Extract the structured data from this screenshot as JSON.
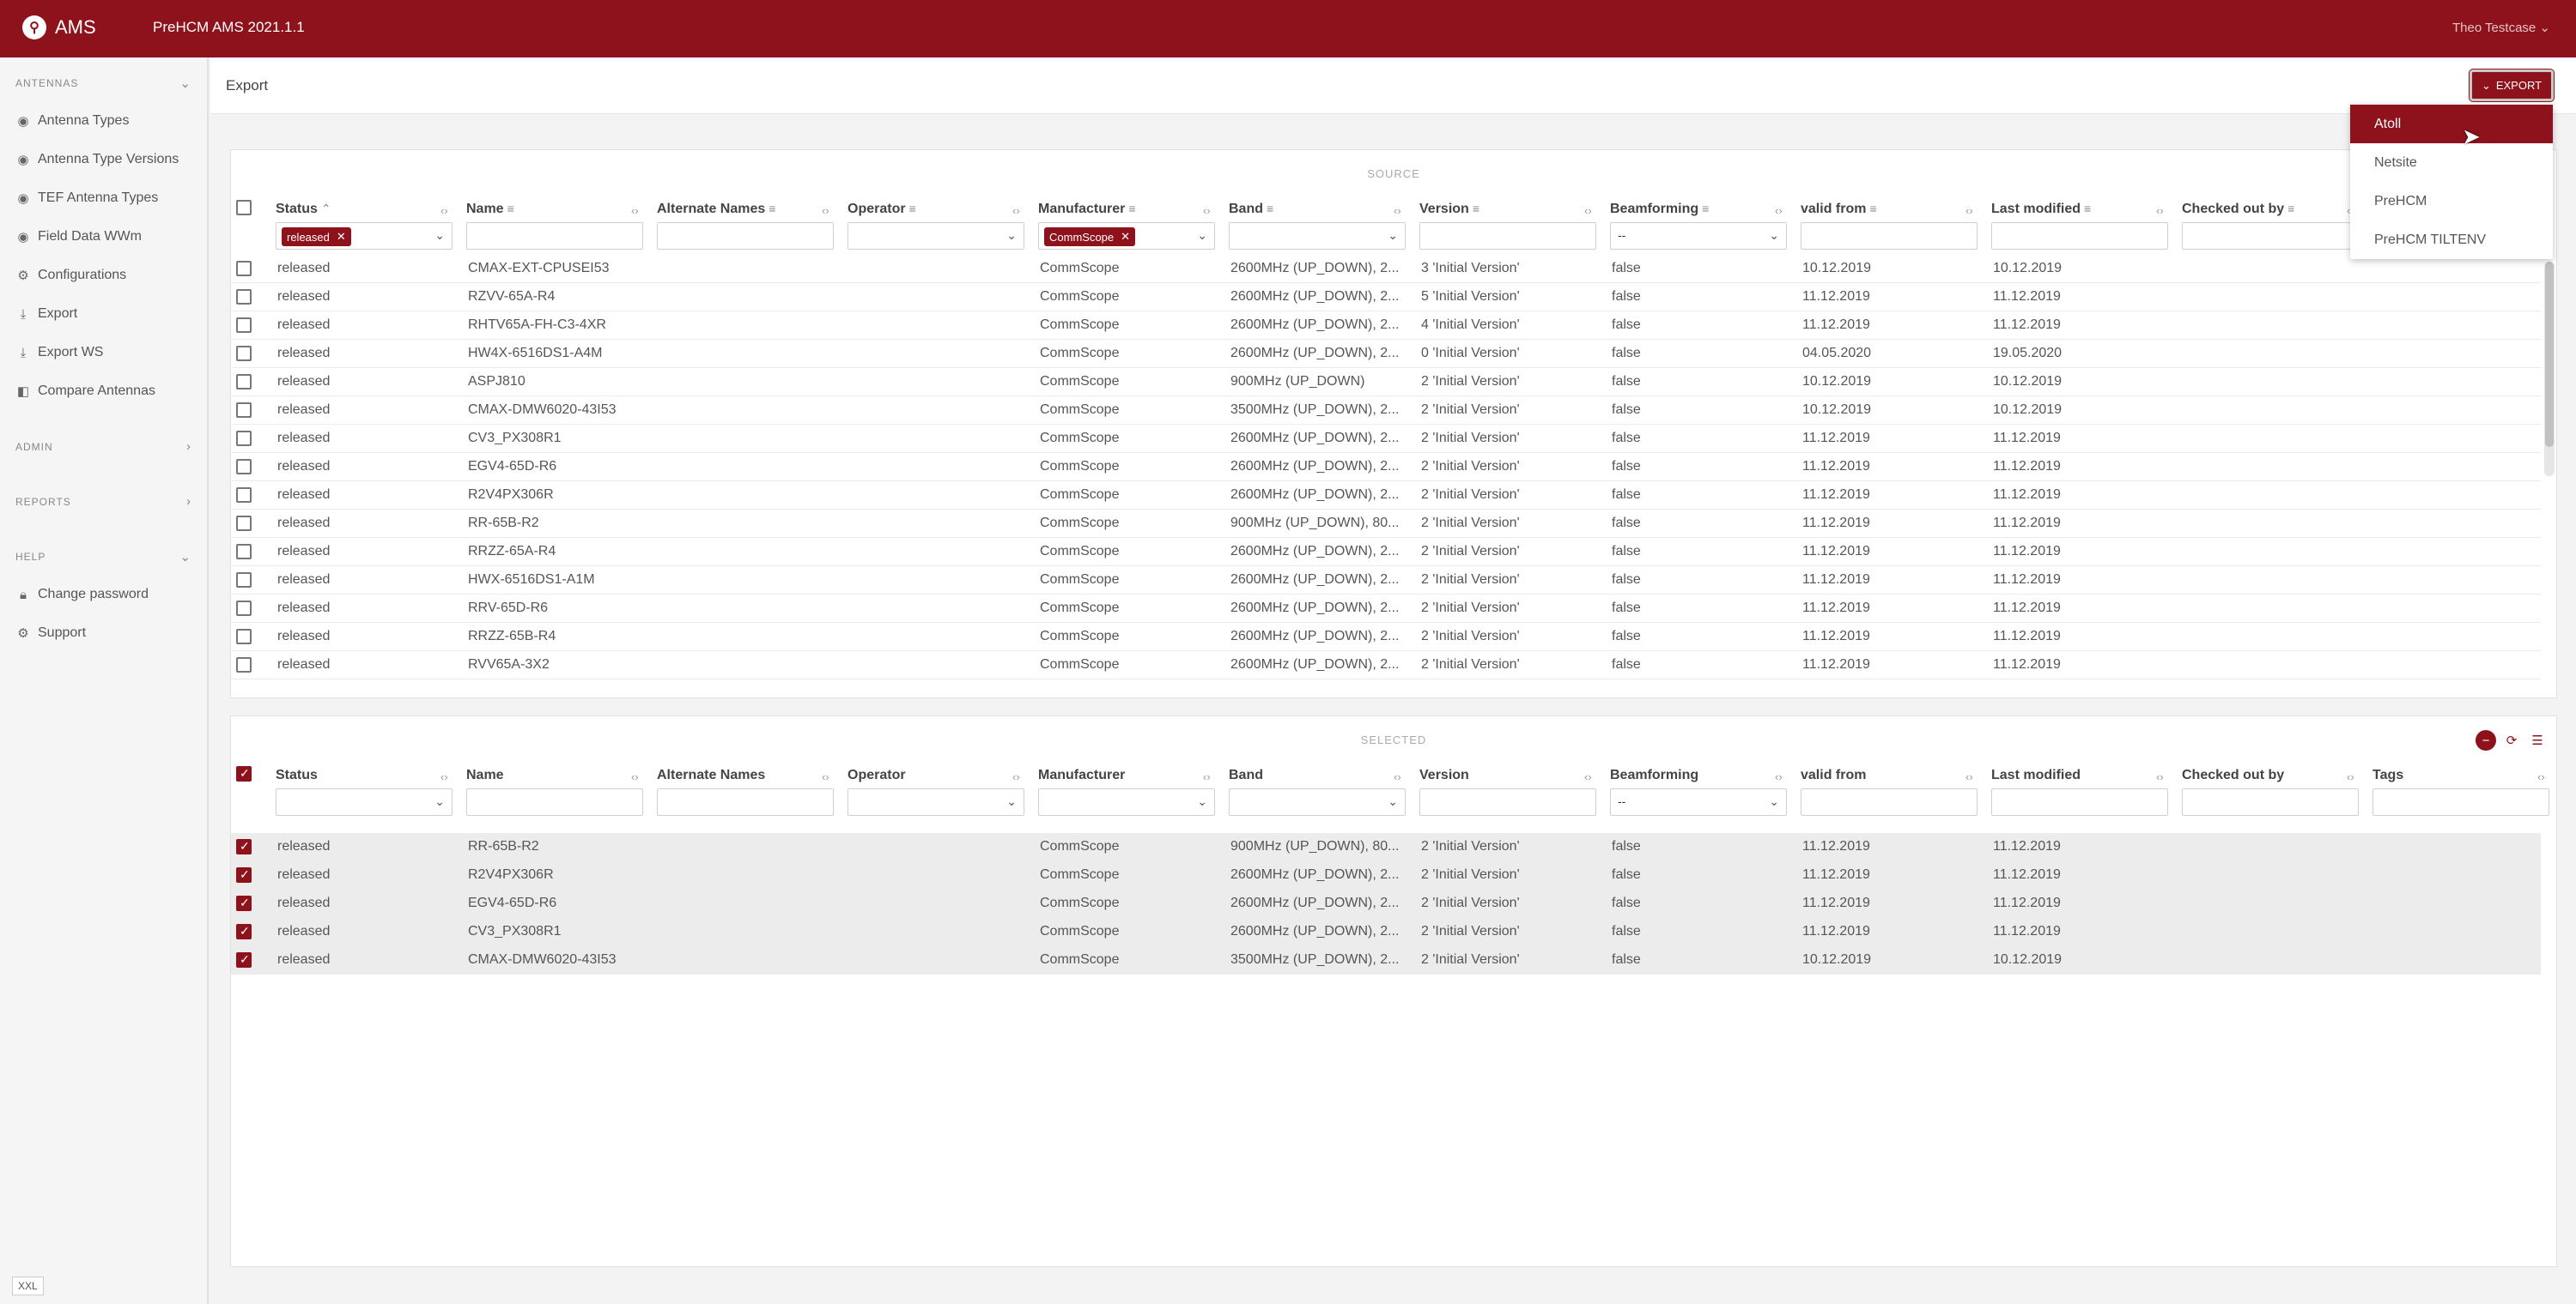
{
  "app": {
    "logo_text": "AMS",
    "title": "PreHCM AMS 2021.1.1",
    "user": "Theo Testcase"
  },
  "sidebar": {
    "sections": [
      {
        "label": "ANTENNAS",
        "chevron": "⌄"
      },
      {
        "label": "ADMIN",
        "chevron": "›"
      },
      {
        "label": "REPORTS",
        "chevron": "›"
      },
      {
        "label": "HELP",
        "chevron": "⌄"
      }
    ],
    "items": [
      {
        "label": "Antenna Types",
        "icon": "antenna-icon"
      },
      {
        "label": "Antenna Type Versions",
        "icon": "antenna-icon"
      },
      {
        "label": "TEF Antenna Types",
        "icon": "antenna-icon"
      },
      {
        "label": "Field Data WWm",
        "icon": "antenna-icon"
      },
      {
        "label": "Configurations",
        "icon": "gear-icon"
      },
      {
        "label": "Export",
        "icon": "download-icon"
      },
      {
        "label": "Export WS",
        "icon": "download-icon"
      },
      {
        "label": "Compare Antennas",
        "icon": "compare-icon"
      },
      {
        "label": "Change password",
        "icon": "lock-icon"
      },
      {
        "label": "Support",
        "icon": "gear-icon"
      }
    ],
    "size_badge": "XXL"
  },
  "page": {
    "title": "Export",
    "export_button": "EXPORT"
  },
  "export_menu": {
    "items": [
      "Atoll",
      "Netsite",
      "PreHCM",
      "PreHCM TILTENV"
    ],
    "active_index": 0
  },
  "source": {
    "label": "SOURCE",
    "columns": [
      "Status",
      "Name",
      "Alternate Names",
      "Operator",
      "Manufacturer",
      "Band",
      "Version",
      "Beamforming",
      "valid from",
      "Last modified",
      "Checked out by"
    ],
    "filters": {
      "status_chip": "released",
      "manufacturer_chip": "CommScope",
      "beamforming": "--"
    },
    "rows": [
      [
        "released",
        "CMAX-EXT-CPUSEI53",
        "CommScope",
        "2600MHz (UP_DOWN), 2...",
        "3 'Initial Version'",
        "false",
        "10.12.2019",
        "10.12.2019"
      ],
      [
        "released",
        "RZVV-65A-R4",
        "CommScope",
        "2600MHz (UP_DOWN), 2...",
        "5 'Initial Version'",
        "false",
        "11.12.2019",
        "11.12.2019"
      ],
      [
        "released",
        "RHTV65A-FH-C3-4XR",
        "CommScope",
        "2600MHz (UP_DOWN), 2...",
        "4 'Initial Version'",
        "false",
        "11.12.2019",
        "11.12.2019"
      ],
      [
        "released",
        "HW4X-6516DS1-A4M",
        "CommScope",
        "2600MHz (UP_DOWN), 2...",
        "0 'Initial Version'",
        "false",
        "04.05.2020",
        "19.05.2020"
      ],
      [
        "released",
        "ASPJ810",
        "CommScope",
        "900MHz (UP_DOWN)",
        "2 'Initial Version'",
        "false",
        "10.12.2019",
        "10.12.2019"
      ],
      [
        "released",
        "CMAX-DMW6020-43I53",
        "CommScope",
        "3500MHz (UP_DOWN), 2...",
        "2 'Initial Version'",
        "false",
        "10.12.2019",
        "10.12.2019"
      ],
      [
        "released",
        "CV3_PX308R1",
        "CommScope",
        "2600MHz (UP_DOWN), 2...",
        "2 'Initial Version'",
        "false",
        "11.12.2019",
        "11.12.2019"
      ],
      [
        "released",
        "EGV4-65D-R6",
        "CommScope",
        "2600MHz (UP_DOWN), 2...",
        "2 'Initial Version'",
        "false",
        "11.12.2019",
        "11.12.2019"
      ],
      [
        "released",
        "R2V4PX306R",
        "CommScope",
        "2600MHz (UP_DOWN), 2...",
        "2 'Initial Version'",
        "false",
        "11.12.2019",
        "11.12.2019"
      ],
      [
        "released",
        "RR-65B-R2",
        "CommScope",
        "900MHz (UP_DOWN), 80...",
        "2 'Initial Version'",
        "false",
        "11.12.2019",
        "11.12.2019"
      ],
      [
        "released",
        "RRZZ-65A-R4",
        "CommScope",
        "2600MHz (UP_DOWN), 2...",
        "2 'Initial Version'",
        "false",
        "11.12.2019",
        "11.12.2019"
      ],
      [
        "released",
        "HWX-6516DS1-A1M",
        "CommScope",
        "2600MHz (UP_DOWN), 2...",
        "2 'Initial Version'",
        "false",
        "11.12.2019",
        "11.12.2019"
      ],
      [
        "released",
        "RRV-65D-R6",
        "CommScope",
        "2600MHz (UP_DOWN), 2...",
        "2 'Initial Version'",
        "false",
        "11.12.2019",
        "11.12.2019"
      ],
      [
        "released",
        "RRZZ-65B-R4",
        "CommScope",
        "2600MHz (UP_DOWN), 2...",
        "2 'Initial Version'",
        "false",
        "11.12.2019",
        "11.12.2019"
      ],
      [
        "released",
        "RVV65A-3X2",
        "CommScope",
        "2600MHz (UP_DOWN), 2...",
        "2 'Initial Version'",
        "false",
        "11.12.2019",
        "11.12.2019"
      ]
    ]
  },
  "selected": {
    "label": "SELECTED",
    "columns": [
      "Status",
      "Name",
      "Alternate Names",
      "Operator",
      "Manufacturer",
      "Band",
      "Version",
      "Beamforming",
      "valid from",
      "Last modified",
      "Checked out by",
      "Tags"
    ],
    "filters": {
      "beamforming": "--"
    },
    "rows": [
      [
        "released",
        "RR-65B-R2",
        "CommScope",
        "900MHz (UP_DOWN), 80...",
        "2 'Initial Version'",
        "false",
        "11.12.2019",
        "11.12.2019"
      ],
      [
        "released",
        "R2V4PX306R",
        "CommScope",
        "2600MHz (UP_DOWN), 2...",
        "2 'Initial Version'",
        "false",
        "11.12.2019",
        "11.12.2019"
      ],
      [
        "released",
        "EGV4-65D-R6",
        "CommScope",
        "2600MHz (UP_DOWN), 2...",
        "2 'Initial Version'",
        "false",
        "11.12.2019",
        "11.12.2019"
      ],
      [
        "released",
        "CV3_PX308R1",
        "CommScope",
        "2600MHz (UP_DOWN), 2...",
        "2 'Initial Version'",
        "false",
        "11.12.2019",
        "11.12.2019"
      ],
      [
        "released",
        "CMAX-DMW6020-43I53",
        "CommScope",
        "3500MHz (UP_DOWN), 2...",
        "2 'Initial Version'",
        "false",
        "10.12.2019",
        "10.12.2019"
      ]
    ]
  },
  "colors": {
    "brand": "#8e121b"
  }
}
